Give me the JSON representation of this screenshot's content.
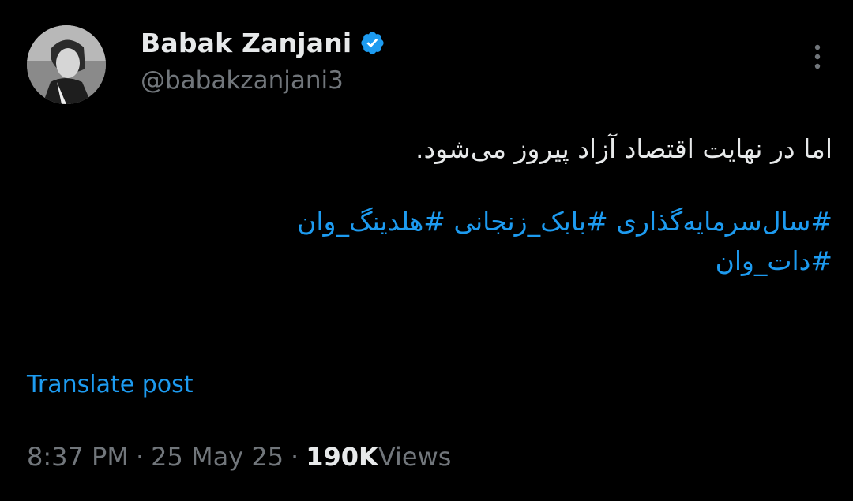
{
  "header": {
    "display_name": "Babak Zanjani",
    "handle": "@babakzanjani3",
    "verified_color": "#1d9bf0"
  },
  "tweet": {
    "text": "اما در نهایت اقتصاد آزاد پیروز می‌شود.",
    "hashtags": [
      "#سال‌سرمایه‌گذاری",
      "#بابک_زنجانی",
      "#هلدینگ_وان",
      "#دات_وان"
    ]
  },
  "actions": {
    "translate_label": "Translate post"
  },
  "meta": {
    "time": "8:37 PM",
    "date": "25 May 25",
    "separator": "·",
    "views_count": "190K",
    "views_label": "Views"
  },
  "icons": {
    "verified": "verified-badge-icon",
    "more": "more-vertical-icon"
  },
  "colors": {
    "background": "#000000",
    "text": "#e7e9ea",
    "secondary": "#71767b",
    "accent": "#1d9bf0"
  }
}
